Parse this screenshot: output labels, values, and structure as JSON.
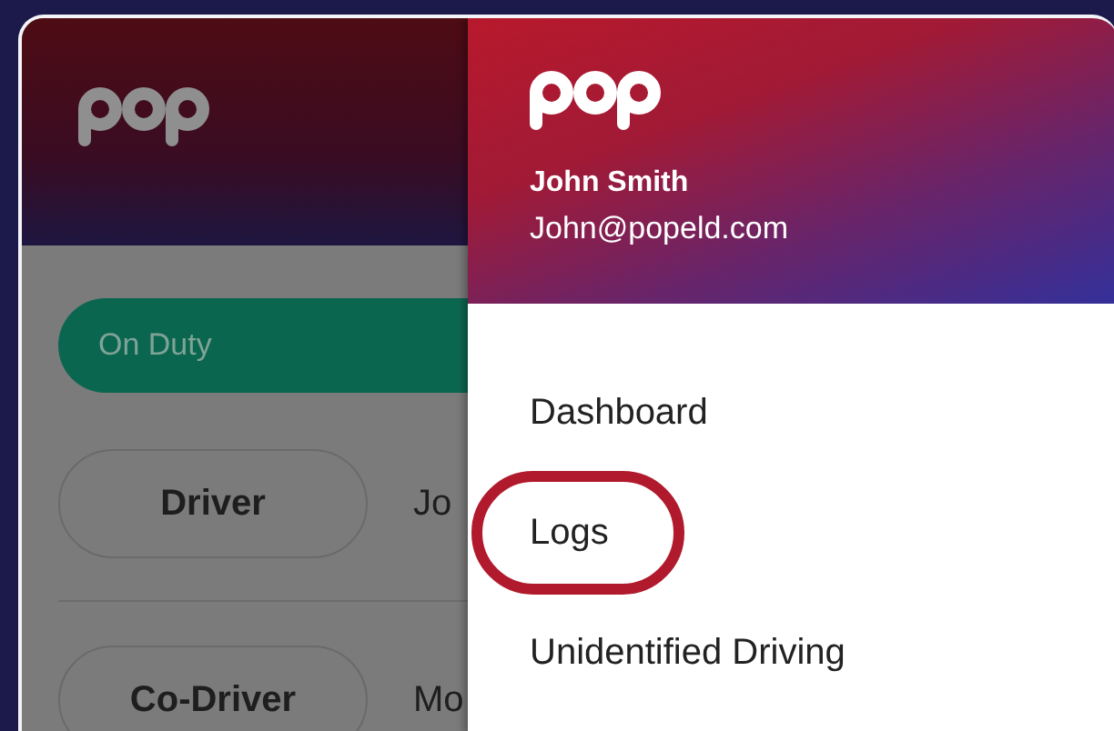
{
  "background_app": {
    "status": {
      "label": "On Duty"
    },
    "rows": [
      {
        "role": "Driver",
        "name": "Jo"
      },
      {
        "role": "Co-Driver",
        "name": "Mo"
      }
    ]
  },
  "drawer": {
    "user": {
      "name": "John Smith",
      "email": "John@popeld.com"
    },
    "menu": [
      {
        "label": "Dashboard",
        "highlighted": false
      },
      {
        "label": "Logs",
        "highlighted": true
      },
      {
        "label": "Unidentified Driving",
        "highlighted": false
      }
    ]
  }
}
